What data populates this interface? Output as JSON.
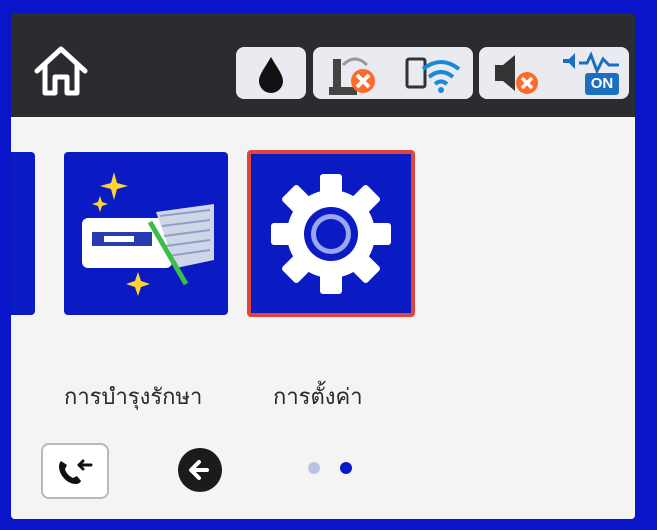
{
  "header": {
    "icons": [
      "home-icon",
      "ink-drop-icon",
      "wired-lan-disconnected-icon",
      "wifi-icon",
      "sound-muted-icon",
      "quiet-mode-on-icon"
    ],
    "quiet_badge": "ON"
  },
  "menu": {
    "items": [
      {
        "label": "การบำรุงรักษา",
        "icon": "maintenance-icon"
      },
      {
        "label": "การตั้งค่า",
        "icon": "gear-icon",
        "selected": true
      }
    ]
  },
  "footer": {
    "icons": [
      "fax-redial-icon",
      "back-arrow-icon"
    ],
    "page_count": 2,
    "current_page": 2
  },
  "colors": {
    "accent": "#0b1bc4",
    "selection": "#e0453d",
    "topbar": "#2b2c30"
  }
}
